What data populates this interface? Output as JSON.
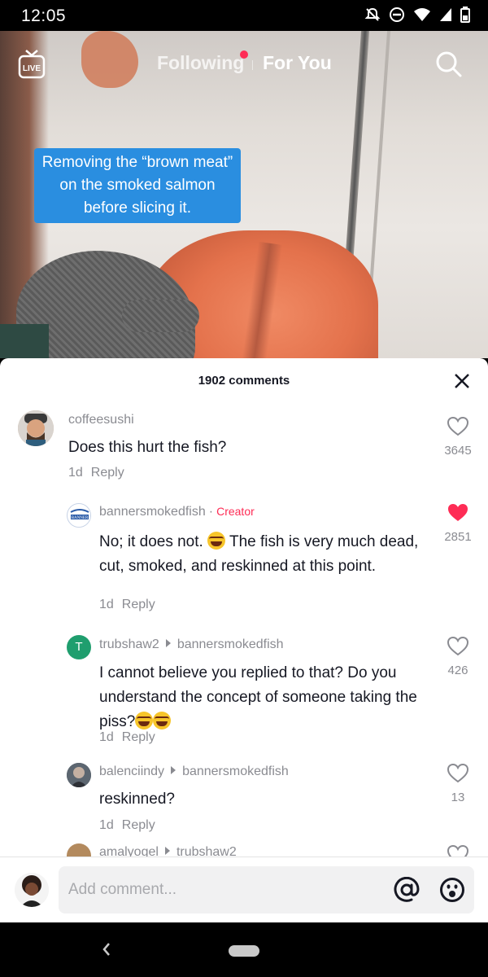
{
  "status_bar": {
    "time": "12:05"
  },
  "video": {
    "caption": "Removing the “brown meat” on the smoked salmon before slicing it."
  },
  "top_nav": {
    "live_label": "LIVE",
    "following": "Following",
    "for_you": "For You"
  },
  "comments_sheet": {
    "title": "1902 comments",
    "comments": [
      {
        "username": "coffeesushi",
        "text": "Does this hurt the fish?",
        "age": "1d",
        "reply": "Reply",
        "likes": "3645",
        "liked": false
      },
      {
        "username": "bannersmokedfish",
        "badge": "Creator",
        "text_a": "No; it does not. ",
        "text_b": " The fish is very much dead, cut, smoked, and reskinned at this point.",
        "age": "1d",
        "reply": "Reply",
        "likes": "2851",
        "liked": true,
        "avatar_text": "BANNER"
      },
      {
        "username": "trubshaw2",
        "reply_to": "bannersmokedfish",
        "text": "I cannot believe you replied to that? Do you understand the concept of someone taking the piss?",
        "age": "1d",
        "reply": "Reply",
        "likes": "426",
        "liked": false,
        "avatar_letter": "T"
      },
      {
        "username": "balenciindy",
        "reply_to": "bannersmokedfish",
        "text": "reskinned?",
        "age": "1d",
        "reply": "Reply",
        "likes": "13",
        "liked": false
      },
      {
        "username": "amalyogel",
        "reply_to": "trubshaw2"
      }
    ],
    "composer": {
      "placeholder": "Add comment..."
    }
  },
  "colors": {
    "accent": "#fe2c55",
    "caption_bg": "#2a8ee0",
    "trubshaw_avatar": "#1f9e6e"
  }
}
